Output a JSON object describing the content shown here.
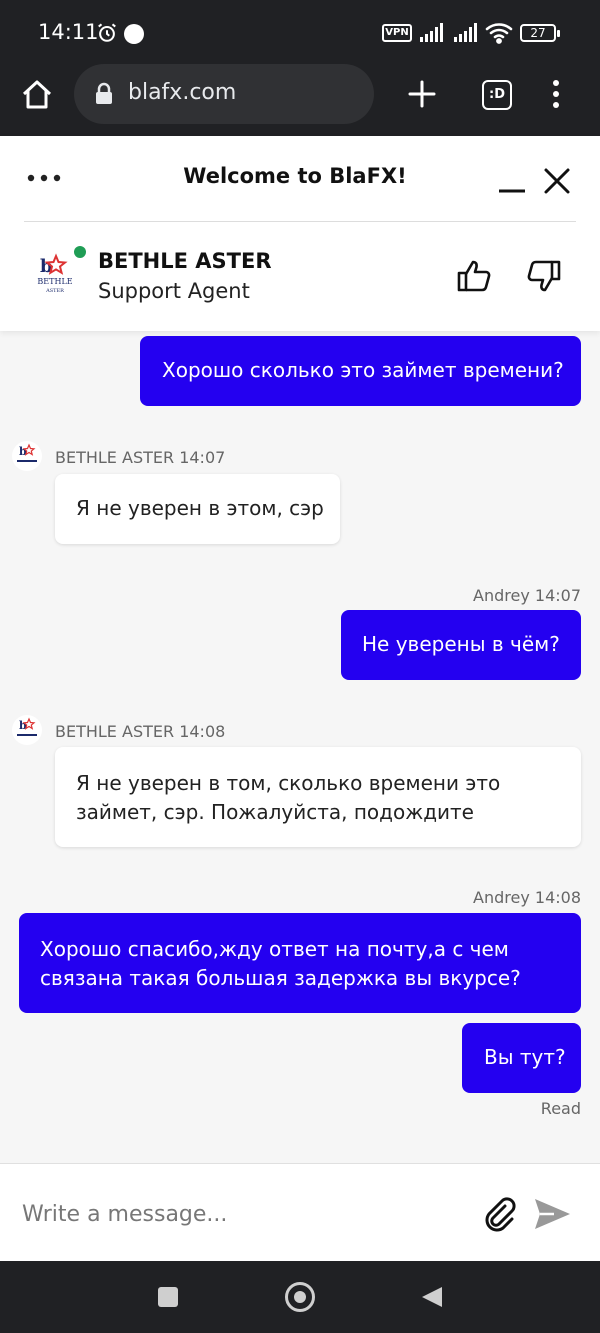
{
  "status_bar": {
    "time": "14:11",
    "vpn_label": "VPN",
    "battery_level": "27",
    "icons": [
      "alarm-icon",
      "notification-dot-icon",
      "vpn-icon",
      "signal-icon",
      "signal-icon",
      "wifi-icon",
      "battery-icon"
    ]
  },
  "browser": {
    "url": "blafx.com",
    "tabs_label": ":D",
    "icons": [
      "home-icon",
      "lock-icon",
      "new-tab-plus-icon",
      "tab-switcher-icon",
      "menu-kebab-icon"
    ]
  },
  "chat_header": {
    "title": "Welcome to BlaFX!",
    "agent_name": "BETHLE ASTER",
    "agent_role": "Support Agent",
    "logo_text": "BETHLE",
    "logo_subtext": "ASTER",
    "online_color": "#1f9d55",
    "icons": [
      "more-options-icon",
      "minimize-icon",
      "close-icon",
      "thumbs-up-icon",
      "thumbs-down-icon"
    ]
  },
  "messages": {
    "m1": {
      "direction": "out",
      "text": "Хорошо сколько это займет времени?"
    },
    "m2": {
      "direction": "in",
      "meta": "BETHLE ASTER 14:07",
      "text": "Я не уверен в этом, сэр"
    },
    "m3": {
      "direction": "out",
      "meta": "Andrey 14:07",
      "text": "Не уверены в чём?"
    },
    "m4": {
      "direction": "in",
      "meta": "BETHLE ASTER 14:08",
      "line1": "Я не уверен в том, сколько времени это",
      "line2": "займет, сэр. Пожалуйста, подождите"
    },
    "m5": {
      "direction": "out",
      "meta": "Andrey 14:08",
      "line1": "Хорошо спасибо,жду ответ на почту,а с чем",
      "line2": "связана такая большая задержка вы вкурсе?"
    },
    "m6": {
      "direction": "out",
      "text": "Вы тут?"
    },
    "read_receipt": "Read"
  },
  "composer": {
    "placeholder": "Write a message...",
    "icons": [
      "attach-paperclip-icon",
      "send-icon"
    ]
  },
  "colors": {
    "outgoing_bubble": "#2400f0",
    "incoming_bubble": "#ffffff",
    "system_bar": "#202124",
    "chat_background": "#f6f6f6"
  },
  "nav_bar": {
    "icons": [
      "recents-square-icon",
      "home-circle-icon",
      "back-triangle-icon"
    ]
  }
}
